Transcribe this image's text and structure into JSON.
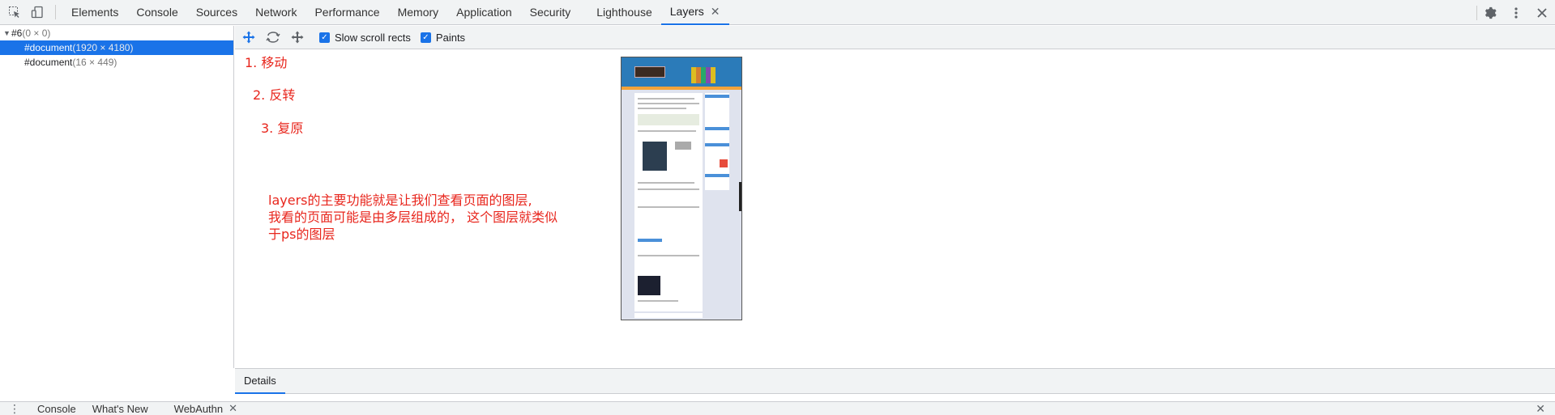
{
  "top_tabs": [
    {
      "label": "Elements"
    },
    {
      "label": "Console"
    },
    {
      "label": "Sources"
    },
    {
      "label": "Network"
    },
    {
      "label": "Performance"
    },
    {
      "label": "Memory"
    },
    {
      "label": "Application"
    },
    {
      "label": "Security"
    },
    {
      "label": "Lighthouse"
    },
    {
      "label": "Layers",
      "active": true,
      "closable": true
    }
  ],
  "tree": {
    "root": {
      "name": "#6",
      "size": "(0 × 0)"
    },
    "items": [
      {
        "name": "#document",
        "size": "(1920 × 4180)",
        "selected": true
      },
      {
        "name": "#document",
        "size": "(16 × 449)",
        "selected": false
      }
    ]
  },
  "layers_toolbar": {
    "slow_scroll_label": "Slow scroll rects",
    "slow_scroll_checked": true,
    "paints_label": "Paints",
    "paints_checked": true
  },
  "annotations": {
    "step1": "1. 移动",
    "step2": "2. 反转",
    "step3": "3. 复原",
    "desc_line1": "layers的主要功能就是让我们查看页面的图层,",
    "desc_line2": "我看的页面可能是由多层组成的， 这个图层就类似",
    "desc_line3": "于ps的图层"
  },
  "details_tab": "Details",
  "drawer": {
    "tabs": [
      {
        "label": "Console"
      },
      {
        "label": "What's New"
      },
      {
        "label": "WebAuthn",
        "closable": true
      }
    ]
  },
  "colors": {
    "accent": "#1a73e8",
    "annotation_red": "#e8261d",
    "toolbar_bg": "#f1f3f4"
  },
  "icons": {
    "inspect": "inspect-element-icon",
    "device": "device-toolbar-icon",
    "settings": "gear-icon",
    "more": "kebab-menu-icon",
    "close": "close-icon",
    "pan": "pan-mode-icon",
    "rotate": "rotate-mode-icon",
    "reset": "reset-transform-icon"
  }
}
